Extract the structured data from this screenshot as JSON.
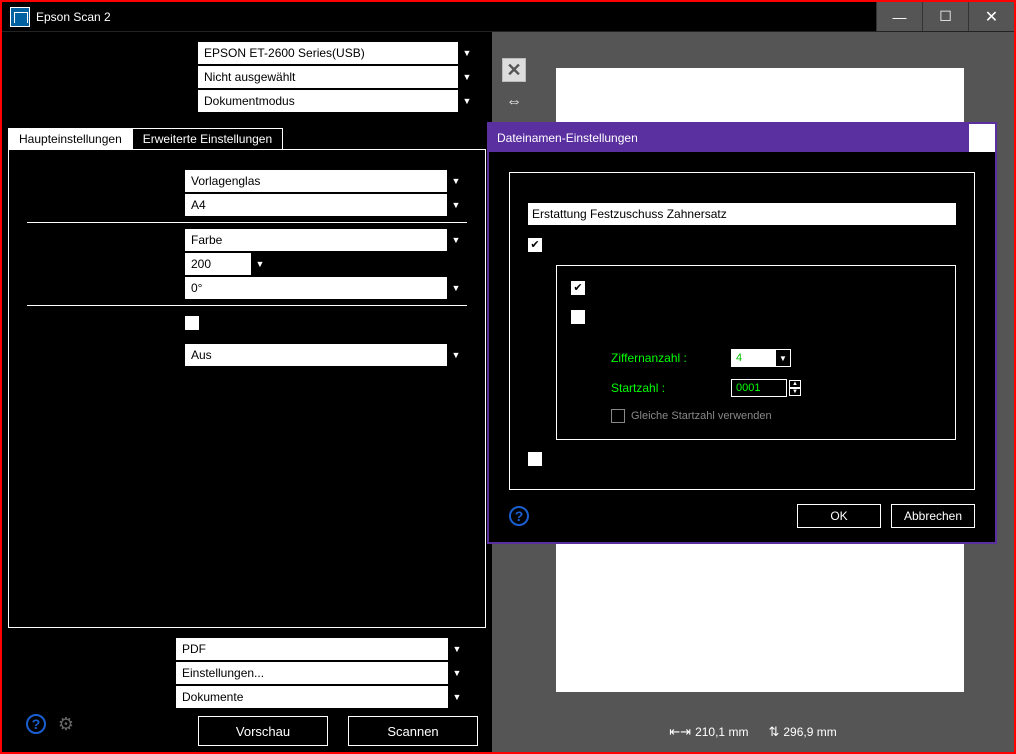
{
  "window": {
    "title": "Epson Scan 2"
  },
  "top_dropdowns": {
    "scanner": "EPSON ET-2600 Series(USB)",
    "selection": "Nicht ausgewählt",
    "mode": "Dokumentmodus"
  },
  "tabs": {
    "main": "Haupteinstellungen",
    "extended": "Erweiterte Einstellungen"
  },
  "main_settings": {
    "source": "Vorlagenglas",
    "size": "A4",
    "color": "Farbe",
    "dpi": "200",
    "rotation": "0°",
    "option": "Aus"
  },
  "bottom": {
    "format": "PDF",
    "settings": "Einstellungen...",
    "folder": "Dokumente",
    "preview_btn": "Vorschau",
    "scan_btn": "Scannen"
  },
  "status": {
    "width": "210,1 mm",
    "height": "296,9 mm"
  },
  "dialog": {
    "title": "Dateinamen-Einstellungen",
    "filename": "Erstattung Festzuschuss Zahnersatz",
    "digits_label": "Ziffernanzahl  :",
    "digits_value": "4",
    "start_label": "Startzahl  :",
    "start_value": "0001",
    "same_start": "Gleiche Startzahl verwenden",
    "ok": "OK",
    "cancel": "Abbrechen"
  }
}
